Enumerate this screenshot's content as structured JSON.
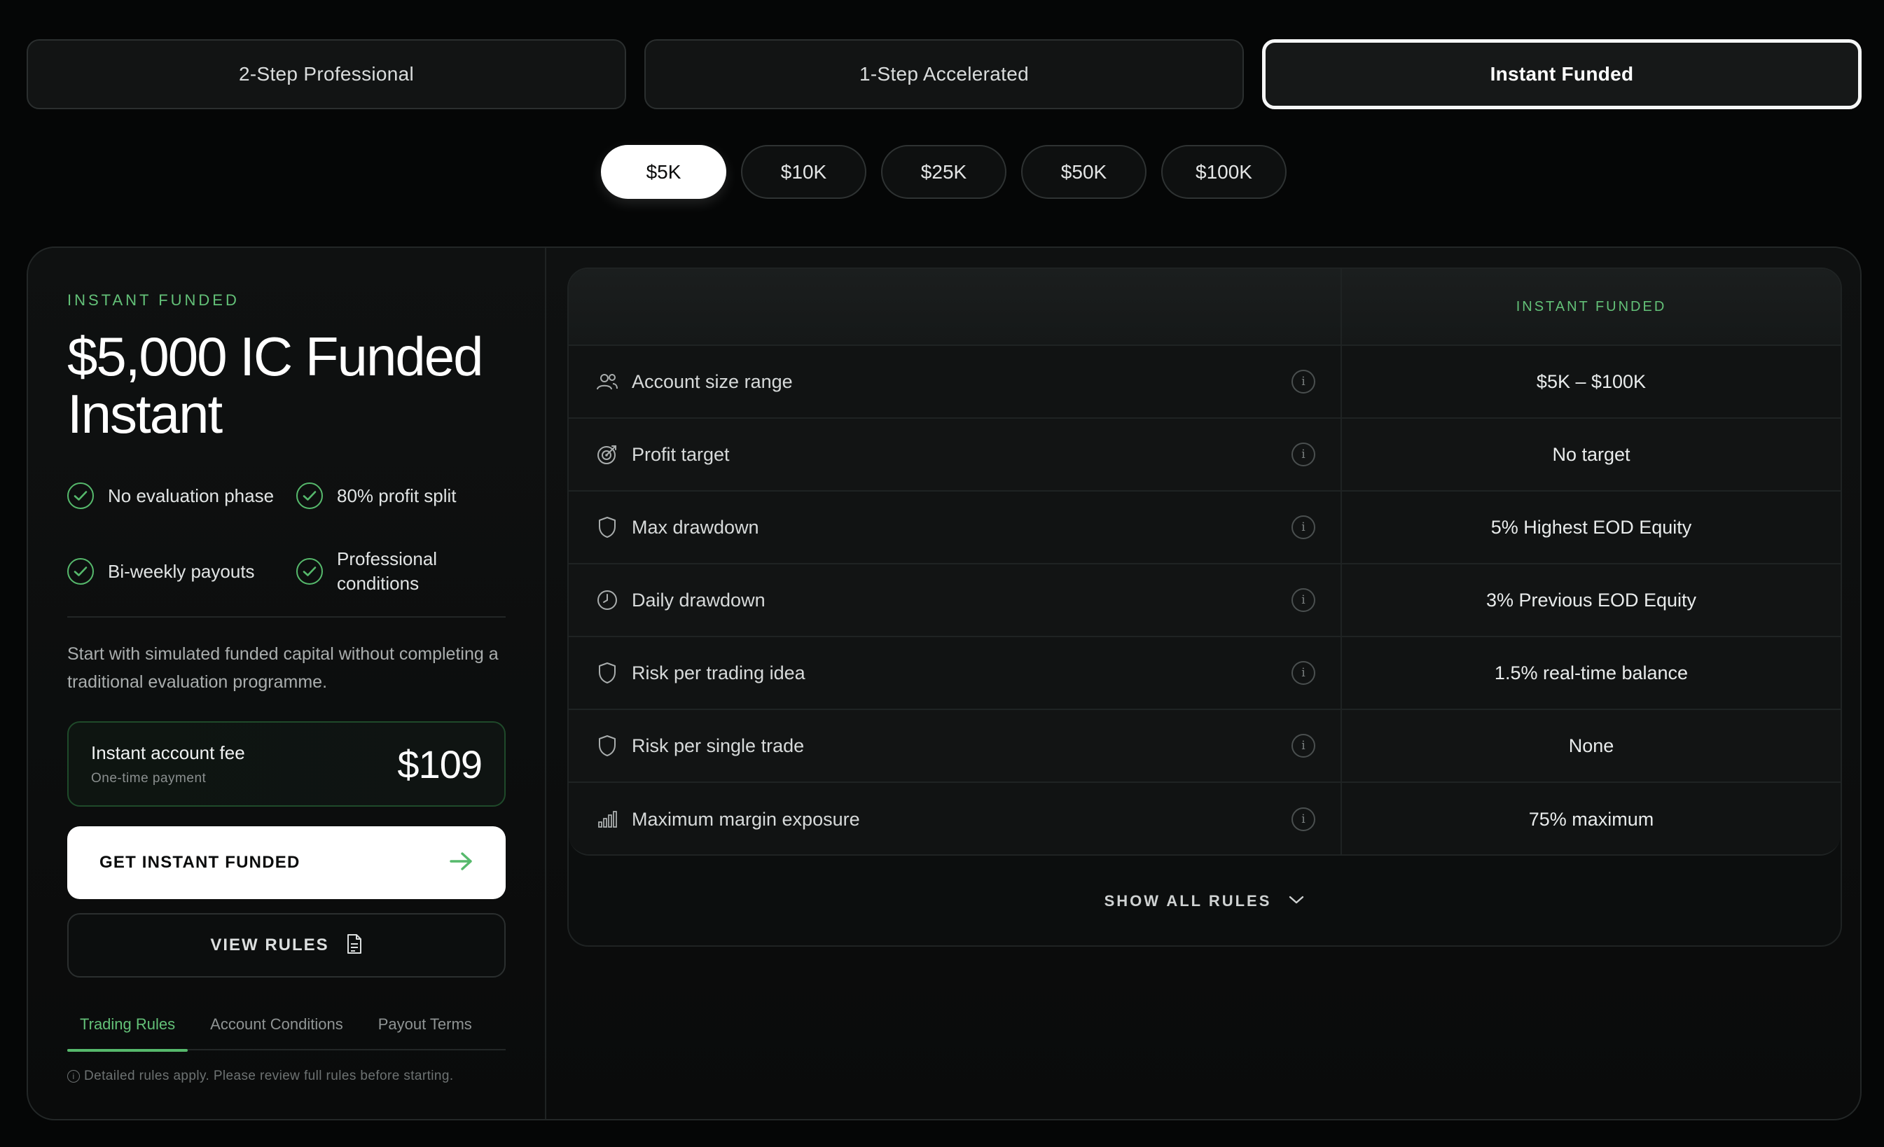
{
  "program_tabs": [
    {
      "label": "2-Step Professional"
    },
    {
      "label": "1-Step Accelerated"
    },
    {
      "label": "Instant Funded"
    }
  ],
  "active_program": "Instant Funded",
  "sizes": [
    {
      "label": "$5K"
    },
    {
      "label": "$10K"
    },
    {
      "label": "$25K"
    },
    {
      "label": "$50K"
    },
    {
      "label": "$100K"
    }
  ],
  "active_size": "$5K",
  "plan": {
    "eyebrow": "INSTANT FUNDED",
    "title": "$5,000 IC Funded Instant",
    "features": [
      {
        "text": "No evaluation phase"
      },
      {
        "text": "80% profit split"
      },
      {
        "text": "Bi-weekly payouts"
      },
      {
        "text": "Professional conditions"
      }
    ],
    "description": "Start with simulated funded capital without completing a traditional evaluation programme.",
    "fee_label": "Instant account fee",
    "fee_sub": "One-time payment",
    "fee_price": "$109",
    "cta_label": "GET INSTANT FUNDED",
    "secondary_label": "VIEW RULES",
    "sub_tabs": [
      {
        "label": "Trading Rules"
      },
      {
        "label": "Account Conditions"
      },
      {
        "label": "Payout Terms"
      }
    ],
    "active_sub_tab": "Trading Rules",
    "disclaimer": "Detailed rules apply. Please review full rules before starting.",
    "disclaimer_icon": "i"
  },
  "table": {
    "column_header": "INSTANT FUNDED",
    "info_glyph": "i",
    "rows": [
      {
        "icon": "users-icon",
        "label": "Account size range",
        "value": "$5K – $100K"
      },
      {
        "icon": "target-icon",
        "label": "Profit target",
        "value": "No target"
      },
      {
        "icon": "shield-icon",
        "label": "Max drawdown",
        "value": "5% Highest EOD Equity"
      },
      {
        "icon": "clock-icon",
        "label": "Daily drawdown",
        "value": "3% Previous EOD Equity"
      },
      {
        "icon": "shield-icon",
        "label": "Risk per trading idea",
        "value": "1.5% real-time balance"
      },
      {
        "icon": "shield-icon",
        "label": "Risk per single trade",
        "value": "None"
      },
      {
        "icon": "bar-chart-icon",
        "label": "Maximum margin exposure",
        "value": "75% maximum"
      }
    ],
    "show_all_label": "SHOW ALL RULES"
  },
  "colors": {
    "accent_green": "#63c178",
    "background": "#050606",
    "card": "#0f1111"
  }
}
